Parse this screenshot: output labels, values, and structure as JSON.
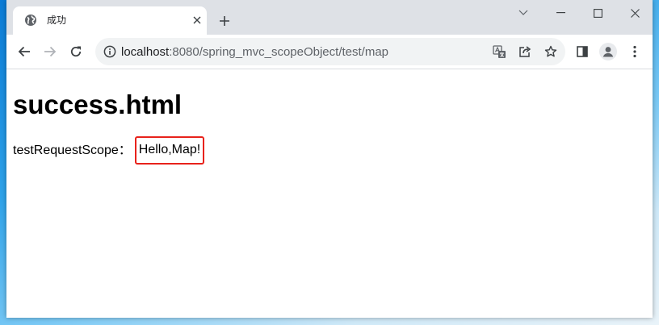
{
  "browser": {
    "tab": {
      "title": "成功"
    },
    "address_bar": {
      "host": "localhost",
      "port_and_path": ":8080/spring_mvc_scopeObject/test/map"
    }
  },
  "page": {
    "heading": "success.html",
    "label": "testRequestScope：",
    "value": "Hello,Map!"
  },
  "colors": {
    "highlight_border": "#e8221b",
    "tabstrip_bg": "#dee1e6",
    "omnibox_bg": "#f1f3f4"
  },
  "icons": {
    "favicon": "globe-icon",
    "tab_close": "close-icon",
    "new_tab": "plus-icon",
    "back": "arrow-left-icon",
    "forward": "arrow-right-icon",
    "reload": "reload-icon",
    "site_info": "info-icon",
    "translate": "translate-icon",
    "share": "share-icon",
    "bookmark": "star-icon",
    "side_panel": "side-panel-icon",
    "profile": "avatar-icon",
    "menu": "kebab-menu-icon"
  }
}
